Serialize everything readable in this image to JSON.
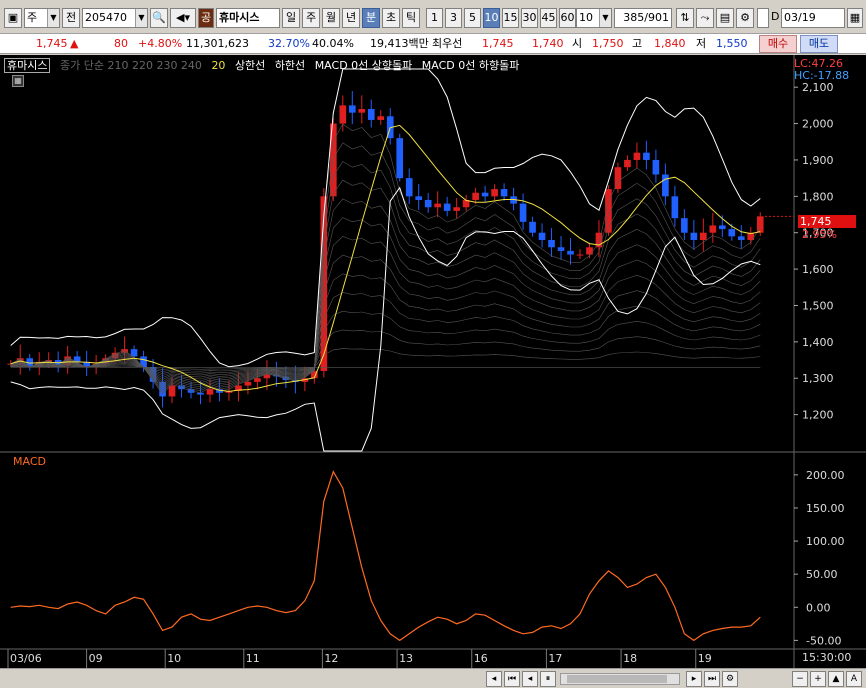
{
  "toolbar": {
    "type_select": "주",
    "prev_label": "전",
    "code": "205470",
    "badge": "공",
    "stock_name": "휴마시스",
    "period_tabs": [
      "일",
      "주",
      "월",
      "년",
      "분",
      "초",
      "틱"
    ],
    "active_period": "분",
    "intervals": [
      "1",
      "3",
      "5",
      "10",
      "15",
      "30",
      "45",
      "60"
    ],
    "active_interval": "10",
    "interval_select": "10",
    "count": "385",
    "total": "/901",
    "d_label": "D",
    "date": "03/19"
  },
  "quote": {
    "price": "1,745",
    "arrow": "▲",
    "change": "80",
    "change_pct": "+4.80%",
    "volume": "11,301,623",
    "pct1": "32.70%",
    "pct2": "40.04%",
    "amount": "19,413백만",
    "best_label": "최우선",
    "best_ask": "1,745",
    "best_bid": "1,740",
    "open_label": "시",
    "open": "1,750",
    "high_label": "고",
    "high": "1,840",
    "low_label": "저",
    "low": "1,550",
    "buy_label": "매수",
    "sell_label": "매도"
  },
  "legend": {
    "name": "휴마시스",
    "ma": "종가 단순 210 220 230 240",
    "ma20": "20",
    "upper": "상한선",
    "lower": "하한선",
    "macd_up": "MACD 0선 상향돌파",
    "macd_down": "MACD 0선 하향돌파"
  },
  "right_labels": {
    "lc": "LC:47.26",
    "hc": "HC:-17.88",
    "current": "1,745",
    "current_pct": "2.95%"
  },
  "colors": {
    "candle_up": "#e02020",
    "candle_down": "#2060ff",
    "bollinger": "#ffffff",
    "ma20": "#f0e040",
    "macd": "#ff6a20",
    "current_box": "#e01010"
  },
  "chart_data": [
    {
      "type": "candlestick",
      "title": "",
      "xlabel": "",
      "ylabel": "",
      "ylim": [
        1100,
        2150
      ],
      "yticks": [
        1200,
        1300,
        1400,
        1500,
        1600,
        1700,
        1800,
        1900,
        2000,
        2100
      ],
      "ytick_labels": [
        "1,200",
        "1,300",
        "1,400",
        "1,500",
        "1,600",
        "1,700",
        "1,800",
        "1,900",
        "2,000",
        "2,100"
      ],
      "x_day_labels": [
        "03/06",
        "09",
        "10",
        "11",
        "12",
        "13",
        "16",
        "17",
        "18",
        "19"
      ],
      "x_day_frac": [
        0.0,
        0.1,
        0.2,
        0.3,
        0.4,
        0.495,
        0.59,
        0.685,
        0.78,
        0.875
      ],
      "current_value": 1745,
      "close_series": [
        1340,
        1355,
        1330,
        1345,
        1350,
        1335,
        1360,
        1345,
        1330,
        1340,
        1355,
        1370,
        1380,
        1360,
        1330,
        1290,
        1250,
        1280,
        1270,
        1260,
        1255,
        1270,
        1260,
        1265,
        1280,
        1290,
        1300,
        1310,
        1305,
        1295,
        1290,
        1300,
        1320,
        1800,
        2000,
        2050,
        2030,
        2040,
        2010,
        2020,
        1960,
        1850,
        1800,
        1790,
        1770,
        1780,
        1760,
        1770,
        1790,
        1810,
        1800,
        1820,
        1800,
        1780,
        1730,
        1700,
        1680,
        1660,
        1650,
        1640,
        1640,
        1660,
        1700,
        1820,
        1880,
        1900,
        1920,
        1900,
        1860,
        1800,
        1740,
        1700,
        1680,
        1700,
        1720,
        1710,
        1690,
        1680,
        1700,
        1745
      ]
    },
    {
      "type": "line",
      "title": "MACD",
      "series": [
        {
          "name": "MACD",
          "values": [
            0,
            2,
            1,
            3,
            0,
            -2,
            5,
            8,
            3,
            -5,
            -10,
            3,
            8,
            15,
            12,
            -10,
            -35,
            -30,
            -15,
            -10,
            -18,
            -20,
            -15,
            -10,
            -5,
            0,
            2,
            0,
            -5,
            -8,
            -5,
            10,
            40,
            160,
            205,
            180,
            120,
            60,
            10,
            -20,
            -40,
            -50,
            -40,
            -30,
            -22,
            -15,
            -18,
            -25,
            -20,
            -10,
            -12,
            -20,
            -28,
            -35,
            -40,
            -38,
            -30,
            -28,
            -32,
            -25,
            -10,
            20,
            40,
            55,
            45,
            30,
            35,
            45,
            50,
            30,
            0,
            -40,
            -50,
            -40,
            -35,
            -32,
            -30,
            -30,
            -28,
            -15
          ]
        }
      ],
      "ylim": [
        -60,
        230
      ],
      "yticks": [
        -50,
        0,
        50,
        100,
        150,
        200
      ],
      "ytick_labels": [
        "-50.00",
        "0.00",
        "50.00",
        "100.00",
        "150.00",
        "200.00"
      ],
      "time_label": "15:30:00"
    }
  ]
}
